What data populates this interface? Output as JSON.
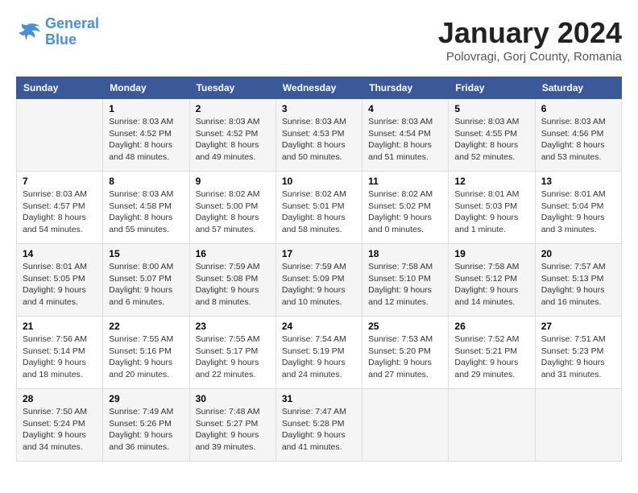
{
  "header": {
    "logo_line1": "General",
    "logo_line2": "Blue",
    "month_title": "January 2024",
    "location": "Polovragi, Gorj County, Romania"
  },
  "weekdays": [
    "Sunday",
    "Monday",
    "Tuesday",
    "Wednesday",
    "Thursday",
    "Friday",
    "Saturday"
  ],
  "weeks": [
    [
      {
        "day": "",
        "sunrise": "",
        "sunset": "",
        "daylight": ""
      },
      {
        "day": "1",
        "sunrise": "Sunrise: 8:03 AM",
        "sunset": "Sunset: 4:52 PM",
        "daylight": "Daylight: 8 hours and 48 minutes."
      },
      {
        "day": "2",
        "sunrise": "Sunrise: 8:03 AM",
        "sunset": "Sunset: 4:52 PM",
        "daylight": "Daylight: 8 hours and 49 minutes."
      },
      {
        "day": "3",
        "sunrise": "Sunrise: 8:03 AM",
        "sunset": "Sunset: 4:53 PM",
        "daylight": "Daylight: 8 hours and 50 minutes."
      },
      {
        "day": "4",
        "sunrise": "Sunrise: 8:03 AM",
        "sunset": "Sunset: 4:54 PM",
        "daylight": "Daylight: 8 hours and 51 minutes."
      },
      {
        "day": "5",
        "sunrise": "Sunrise: 8:03 AM",
        "sunset": "Sunset: 4:55 PM",
        "daylight": "Daylight: 8 hours and 52 minutes."
      },
      {
        "day": "6",
        "sunrise": "Sunrise: 8:03 AM",
        "sunset": "Sunset: 4:56 PM",
        "daylight": "Daylight: 8 hours and 53 minutes."
      }
    ],
    [
      {
        "day": "7",
        "sunrise": "Sunrise: 8:03 AM",
        "sunset": "Sunset: 4:57 PM",
        "daylight": "Daylight: 8 hours and 54 minutes."
      },
      {
        "day": "8",
        "sunrise": "Sunrise: 8:03 AM",
        "sunset": "Sunset: 4:58 PM",
        "daylight": "Daylight: 8 hours and 55 minutes."
      },
      {
        "day": "9",
        "sunrise": "Sunrise: 8:02 AM",
        "sunset": "Sunset: 5:00 PM",
        "daylight": "Daylight: 8 hours and 57 minutes."
      },
      {
        "day": "10",
        "sunrise": "Sunrise: 8:02 AM",
        "sunset": "Sunset: 5:01 PM",
        "daylight": "Daylight: 8 hours and 58 minutes."
      },
      {
        "day": "11",
        "sunrise": "Sunrise: 8:02 AM",
        "sunset": "Sunset: 5:02 PM",
        "daylight": "Daylight: 9 hours and 0 minutes."
      },
      {
        "day": "12",
        "sunrise": "Sunrise: 8:01 AM",
        "sunset": "Sunset: 5:03 PM",
        "daylight": "Daylight: 9 hours and 1 minute."
      },
      {
        "day": "13",
        "sunrise": "Sunrise: 8:01 AM",
        "sunset": "Sunset: 5:04 PM",
        "daylight": "Daylight: 9 hours and 3 minutes."
      }
    ],
    [
      {
        "day": "14",
        "sunrise": "Sunrise: 8:01 AM",
        "sunset": "Sunset: 5:05 PM",
        "daylight": "Daylight: 9 hours and 4 minutes."
      },
      {
        "day": "15",
        "sunrise": "Sunrise: 8:00 AM",
        "sunset": "Sunset: 5:07 PM",
        "daylight": "Daylight: 9 hours and 6 minutes."
      },
      {
        "day": "16",
        "sunrise": "Sunrise: 7:59 AM",
        "sunset": "Sunset: 5:08 PM",
        "daylight": "Daylight: 9 hours and 8 minutes."
      },
      {
        "day": "17",
        "sunrise": "Sunrise: 7:59 AM",
        "sunset": "Sunset: 5:09 PM",
        "daylight": "Daylight: 9 hours and 10 minutes."
      },
      {
        "day": "18",
        "sunrise": "Sunrise: 7:58 AM",
        "sunset": "Sunset: 5:10 PM",
        "daylight": "Daylight: 9 hours and 12 minutes."
      },
      {
        "day": "19",
        "sunrise": "Sunrise: 7:58 AM",
        "sunset": "Sunset: 5:12 PM",
        "daylight": "Daylight: 9 hours and 14 minutes."
      },
      {
        "day": "20",
        "sunrise": "Sunrise: 7:57 AM",
        "sunset": "Sunset: 5:13 PM",
        "daylight": "Daylight: 9 hours and 16 minutes."
      }
    ],
    [
      {
        "day": "21",
        "sunrise": "Sunrise: 7:56 AM",
        "sunset": "Sunset: 5:14 PM",
        "daylight": "Daylight: 9 hours and 18 minutes."
      },
      {
        "day": "22",
        "sunrise": "Sunrise: 7:55 AM",
        "sunset": "Sunset: 5:16 PM",
        "daylight": "Daylight: 9 hours and 20 minutes."
      },
      {
        "day": "23",
        "sunrise": "Sunrise: 7:55 AM",
        "sunset": "Sunset: 5:17 PM",
        "daylight": "Daylight: 9 hours and 22 minutes."
      },
      {
        "day": "24",
        "sunrise": "Sunrise: 7:54 AM",
        "sunset": "Sunset: 5:19 PM",
        "daylight": "Daylight: 9 hours and 24 minutes."
      },
      {
        "day": "25",
        "sunrise": "Sunrise: 7:53 AM",
        "sunset": "Sunset: 5:20 PM",
        "daylight": "Daylight: 9 hours and 27 minutes."
      },
      {
        "day": "26",
        "sunrise": "Sunrise: 7:52 AM",
        "sunset": "Sunset: 5:21 PM",
        "daylight": "Daylight: 9 hours and 29 minutes."
      },
      {
        "day": "27",
        "sunrise": "Sunrise: 7:51 AM",
        "sunset": "Sunset: 5:23 PM",
        "daylight": "Daylight: 9 hours and 31 minutes."
      }
    ],
    [
      {
        "day": "28",
        "sunrise": "Sunrise: 7:50 AM",
        "sunset": "Sunset: 5:24 PM",
        "daylight": "Daylight: 9 hours and 34 minutes."
      },
      {
        "day": "29",
        "sunrise": "Sunrise: 7:49 AM",
        "sunset": "Sunset: 5:26 PM",
        "daylight": "Daylight: 9 hours and 36 minutes."
      },
      {
        "day": "30",
        "sunrise": "Sunrise: 7:48 AM",
        "sunset": "Sunset: 5:27 PM",
        "daylight": "Daylight: 9 hours and 39 minutes."
      },
      {
        "day": "31",
        "sunrise": "Sunrise: 7:47 AM",
        "sunset": "Sunset: 5:28 PM",
        "daylight": "Daylight: 9 hours and 41 minutes."
      },
      {
        "day": "",
        "sunrise": "",
        "sunset": "",
        "daylight": ""
      },
      {
        "day": "",
        "sunrise": "",
        "sunset": "",
        "daylight": ""
      },
      {
        "day": "",
        "sunrise": "",
        "sunset": "",
        "daylight": ""
      }
    ]
  ]
}
